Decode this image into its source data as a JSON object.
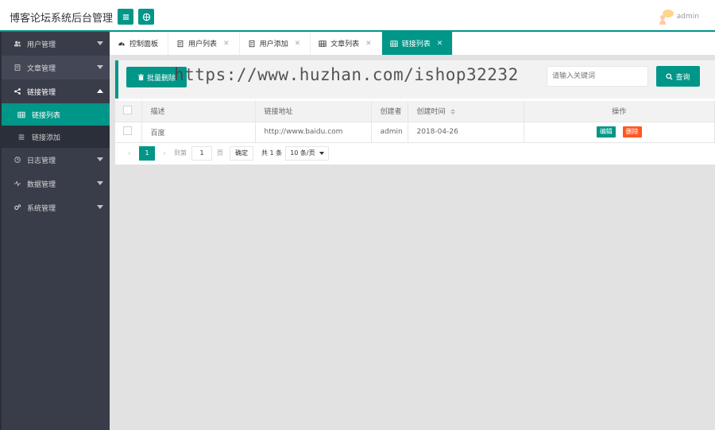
{
  "header": {
    "title": "博客论坛系统后台管理",
    "username": "admin"
  },
  "sidebar": {
    "items": [
      {
        "label": "用户管理",
        "icon": "users-icon"
      },
      {
        "label": "文章管理",
        "icon": "document-icon"
      },
      {
        "label": "链接管理",
        "icon": "share-icon",
        "expanded": true,
        "children": [
          {
            "label": "链接列表",
            "icon": "table-icon",
            "selected": true
          },
          {
            "label": "链接添加",
            "icon": "list-icon"
          }
        ]
      },
      {
        "label": "日志管理",
        "icon": "clock-icon"
      },
      {
        "label": "数据管理",
        "icon": "pulse-icon"
      },
      {
        "label": "系统管理",
        "icon": "gears-icon"
      }
    ]
  },
  "tabs": [
    {
      "label": "控制面板",
      "icon": "dashboard-icon",
      "closable": false
    },
    {
      "label": "用户列表",
      "icon": "file-icon",
      "closable": true
    },
    {
      "label": "用户添加",
      "icon": "file-icon",
      "closable": true
    },
    {
      "label": "文章列表",
      "icon": "table-icon",
      "closable": true
    },
    {
      "label": "链接列表",
      "icon": "table-icon",
      "closable": true,
      "active": true
    }
  ],
  "toolbar": {
    "batch_delete_label": "批量删除",
    "watermark": "https://www.huzhan.com/ishop32232",
    "search_placeholder": "请输入关键词",
    "search_label": "查询"
  },
  "table": {
    "columns": [
      "描述",
      "链接地址",
      "创建者",
      "创建时间",
      "操作"
    ],
    "rows": [
      {
        "desc": "百度",
        "url": "http://www.baidu.com",
        "creator": "admin",
        "created": "2018-04-26",
        "edit": "编辑",
        "delete": "删除"
      }
    ]
  },
  "pagination": {
    "current_page": "1",
    "goto_label": "到第",
    "goto_value": "1",
    "page_unit": "页",
    "confirm_label": "确定",
    "total_label": "共 1 条",
    "page_size": "10 条/页"
  },
  "colors": {
    "accent": "#009688",
    "danger": "#ff5722",
    "sidebar_bg": "#393d49"
  }
}
